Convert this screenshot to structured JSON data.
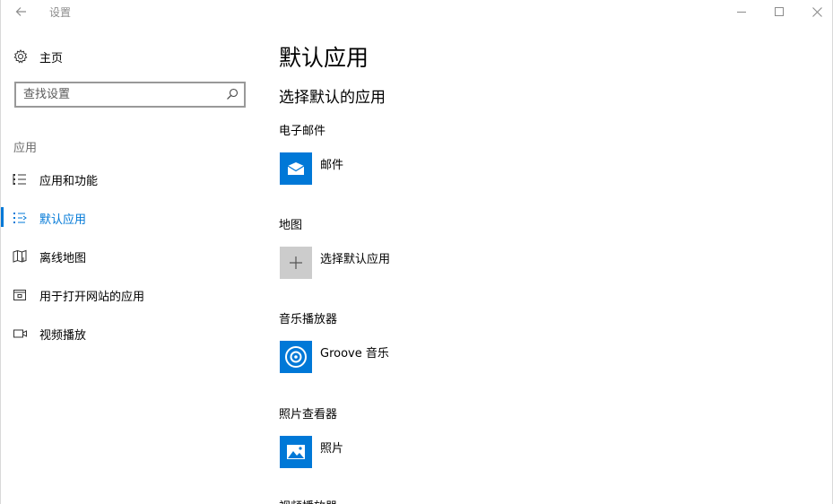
{
  "window": {
    "title": "设置"
  },
  "sidebar": {
    "home_label": "主页",
    "search_placeholder": "查找设置",
    "section_heading": "应用",
    "items": [
      {
        "label": "应用和功能",
        "icon": "list-icon",
        "active": false
      },
      {
        "label": "默认应用",
        "icon": "default-apps-icon",
        "active": true
      },
      {
        "label": "离线地图",
        "icon": "offline-map-icon",
        "active": false
      },
      {
        "label": "用于打开网站的应用",
        "icon": "website-app-icon",
        "active": false
      },
      {
        "label": "视频播放",
        "icon": "video-icon",
        "active": false
      }
    ]
  },
  "main": {
    "title": "默认应用",
    "subtitle": "选择默认的应用",
    "categories": [
      {
        "label": "电子邮件",
        "app_name": "邮件",
        "icon": "mail-icon"
      },
      {
        "label": "地图",
        "app_name": "选择默认应用",
        "icon": "plus-icon"
      },
      {
        "label": "音乐播放器",
        "app_name": "Groove 音乐",
        "icon": "groove-music-icon"
      },
      {
        "label": "照片查看器",
        "app_name": "照片",
        "icon": "photos-icon"
      },
      {
        "label": "视频播放器"
      }
    ]
  },
  "colors": {
    "accent": "#0078d7",
    "placeholder_tile": "#cccccc",
    "secondary_text": "#6b6b6b"
  }
}
